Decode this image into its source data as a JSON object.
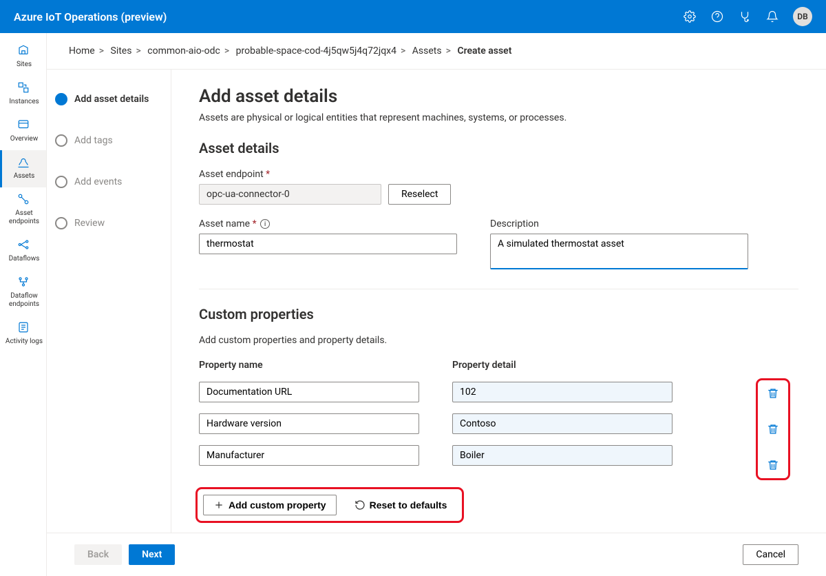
{
  "header": {
    "product_title": "Azure IoT Operations (preview)",
    "user_initials": "DB"
  },
  "leftnav": [
    {
      "label": "Sites"
    },
    {
      "label": "Instances"
    },
    {
      "label": "Overview"
    },
    {
      "label": "Assets"
    },
    {
      "label": "Asset endpoints"
    },
    {
      "label": "Dataflows"
    },
    {
      "label": "Dataflow endpoints"
    },
    {
      "label": "Activity logs"
    }
  ],
  "breadcrumb": {
    "items": [
      "Home",
      "Sites",
      "common-aio-odc",
      "probable-space-cod-4j5qw5j4q72jqx4",
      "Assets"
    ],
    "current": "Create asset"
  },
  "steps": [
    {
      "label": "Add asset details",
      "active": true
    },
    {
      "label": "Add tags",
      "active": false
    },
    {
      "label": "Add events",
      "active": false
    },
    {
      "label": "Review",
      "active": false
    }
  ],
  "page": {
    "title": "Add asset details",
    "description": "Assets are physical or logical entities that represent machines, systems, or processes."
  },
  "asset_details": {
    "section_title": "Asset details",
    "endpoint_label": "Asset endpoint",
    "endpoint_value": "opc-ua-connector-0",
    "reselect_label": "Reselect",
    "name_label": "Asset name",
    "name_value": "thermostat",
    "description_label": "Description",
    "description_value": "A simulated thermostat asset"
  },
  "custom_properties": {
    "section_title": "Custom properties",
    "description": "Add custom properties and property details.",
    "name_header": "Property name",
    "detail_header": "Property detail",
    "rows": [
      {
        "name": "Documentation URL",
        "detail": "102"
      },
      {
        "name": "Hardware version",
        "detail": "Contoso"
      },
      {
        "name": "Manufacturer",
        "detail": "Boiler"
      }
    ],
    "add_label": "Add custom property",
    "reset_label": "Reset to defaults"
  },
  "footer": {
    "back": "Back",
    "next": "Next",
    "cancel": "Cancel"
  }
}
